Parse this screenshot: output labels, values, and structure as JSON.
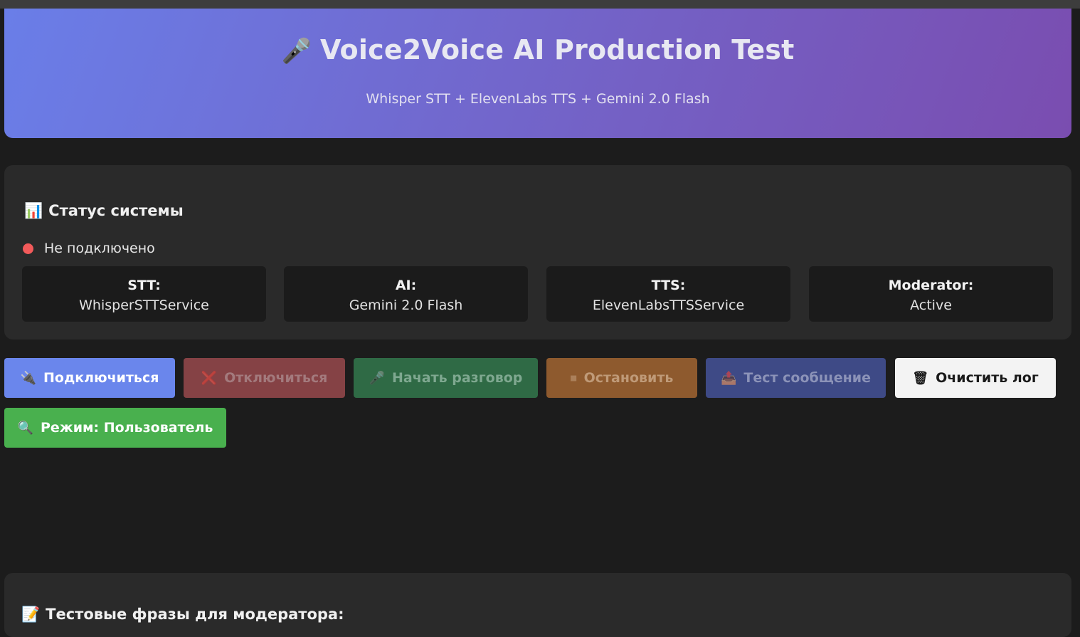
{
  "header": {
    "icon": "microphone-icon",
    "icon_glyph": "🎤",
    "title": "Voice2Voice AI Production Test",
    "subtitle": "Whisper STT + ElevenLabs TTS + Gemini 2.0 Flash"
  },
  "status": {
    "heading_icon": "bar-chart-icon",
    "heading_icon_glyph": "📊",
    "heading": "Статус системы",
    "connection_text": "Не подключено",
    "connection_color": "#f25a5a",
    "services": [
      {
        "label": "STT:",
        "value": "WhisperSTTService"
      },
      {
        "label": "AI:",
        "value": "Gemini 2.0 Flash"
      },
      {
        "label": "TTS:",
        "value": "ElevenLabsTTSService"
      },
      {
        "label": "Moderator:",
        "value": "Active"
      }
    ]
  },
  "controls": {
    "connect": {
      "icon": "plug-icon",
      "glyph": "🔌",
      "label": "Подключиться",
      "color": "#6a86ec"
    },
    "disconnect": {
      "icon": "cross-icon",
      "glyph": "❌",
      "label": "Отключиться",
      "color": "#854245"
    },
    "start": {
      "icon": "microphone-icon",
      "glyph": "🎤",
      "label": "Начать разговор",
      "color": "#2f6a45"
    },
    "stop": {
      "icon": "stop-icon",
      "glyph": "⏹",
      "label": "Остановить",
      "color": "#8e5a2e"
    },
    "test": {
      "icon": "inbox-icon",
      "glyph": "📤",
      "label": "Тест сообщение",
      "color": "#3e4a86"
    },
    "clear": {
      "icon": "trash-icon",
      "glyph": "🗑",
      "label": "Очистить лог",
      "color": "#f3f3f3"
    },
    "mode": {
      "icon": "magnifier-icon",
      "glyph": "🔍",
      "label": "Режим: Пользователь",
      "color": "#49b04e"
    }
  },
  "phrases": {
    "heading_icon": "memo-icon",
    "heading_icon_glyph": "📝",
    "heading": "Тестовые фразы для модератора:"
  }
}
